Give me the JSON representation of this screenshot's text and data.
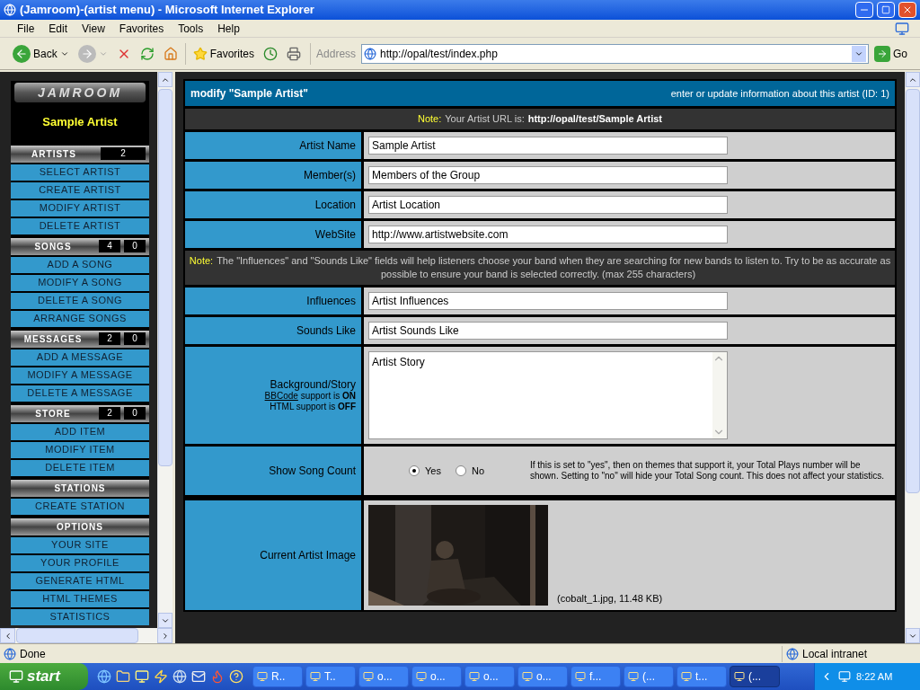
{
  "window": {
    "title": "(Jamroom)-(artist menu) - Microsoft Internet Explorer"
  },
  "menu": [
    "File",
    "Edit",
    "View",
    "Favorites",
    "Tools",
    "Help"
  ],
  "toolbar": {
    "back": "Back",
    "favorites": "Favorites",
    "address_label": "Address",
    "address": "http://opal/test/index.php",
    "go": "Go"
  },
  "sidebar": {
    "logo": "JAMROOM",
    "artist": "Sample Artist",
    "sections": [
      {
        "title": "ARTISTS",
        "counts": [
          "2"
        ],
        "items": [
          "SELECT ARTIST",
          "CREATE ARTIST",
          "MODIFY ARTIST",
          "DELETE ARTIST"
        ]
      },
      {
        "title": "SONGS",
        "counts": [
          "4",
          "0"
        ],
        "items": [
          "ADD A SONG",
          "MODIFY A SONG",
          "DELETE A SONG",
          "ARRANGE SONGS"
        ]
      },
      {
        "title": "MESSAGES",
        "counts": [
          "2",
          "0"
        ],
        "items": [
          "ADD A MESSAGE",
          "MODIFY A MESSAGE",
          "DELETE A MESSAGE"
        ]
      },
      {
        "title": "STORE",
        "counts": [
          "2",
          "0"
        ],
        "items": [
          "ADD ITEM",
          "MODIFY ITEM",
          "DELETE ITEM"
        ]
      },
      {
        "title": "STATIONS",
        "items": [
          "CREATE STATION"
        ]
      },
      {
        "title": "OPTIONS",
        "items": [
          "YOUR SITE",
          "YOUR PROFILE",
          "GENERATE HTML",
          "HTML THEMES",
          "STATISTICS"
        ]
      }
    ]
  },
  "form": {
    "title": "modify \"Sample Artist\"",
    "subtitle": "enter or update information about this artist (ID: 1)",
    "rows": [
      {
        "kind": "note",
        "label": "Note:",
        "text": "Your Artist URL is:",
        "url": "http://opal/test/Sample Artist"
      },
      {
        "kind": "text",
        "label": "Artist Name",
        "value": "Sample Artist"
      },
      {
        "kind": "text",
        "label": "Member(s)",
        "value": "Members of the Group"
      },
      {
        "kind": "text",
        "label": "Location",
        "value": "Artist Location"
      },
      {
        "kind": "text",
        "label": "WebSite",
        "value": "http://www.artistwebsite.com"
      },
      {
        "kind": "note",
        "label": "Note:",
        "text": "The \"Influences\" and \"Sounds Like\" fields will help listeners choose your band when they are searching for new bands to listen to. Try to be as accurate as possible to ensure your band is selected correctly. (max 255 characters)"
      },
      {
        "kind": "text",
        "label": "Influences",
        "value": "Artist Influences"
      },
      {
        "kind": "text",
        "label": "Sounds Like",
        "value": "Artist Sounds Like"
      },
      {
        "kind": "textarea",
        "label": "Background/Story",
        "link": "BBCode",
        "line1": "support is **ON**",
        "line2": "HTML support is **OFF**",
        "value": "Artist Story"
      },
      {
        "kind": "radio",
        "label": "Show Song Count",
        "options": [
          {
            "label": "Yes",
            "selected": true
          },
          {
            "label": "No",
            "selected": false
          }
        ],
        "help": "If this is set to \"yes\", then on themes that support it, your Total Plays number will be shown. Setting to \"no\" will hide your Total Song count. This does not affect your statistics."
      },
      {
        "label": "Current Artist Image",
        "caption": "(cobalt_1.jpg, 11.48 KB)"
      }
    ]
  },
  "status_bar": {
    "text": "Done",
    "zone": "Local intranet"
  },
  "taskbar": {
    "start": "start",
    "clock": "8:22 AM",
    "tasks": [
      {
        "label": "R..",
        "selected": false
      },
      {
        "label": "T..",
        "selected": false
      },
      {
        "label": "o...",
        "selected": false
      },
      {
        "label": "o...",
        "selected": false
      },
      {
        "label": "o...",
        "selected": false
      },
      {
        "label": "o...",
        "selected": false
      },
      {
        "label": "f...",
        "selected": false
      },
      {
        "label": "(...",
        "selected": false
      },
      {
        "label": "t...",
        "selected": false
      },
      {
        "label": "(...",
        "selected": true
      }
    ]
  }
}
